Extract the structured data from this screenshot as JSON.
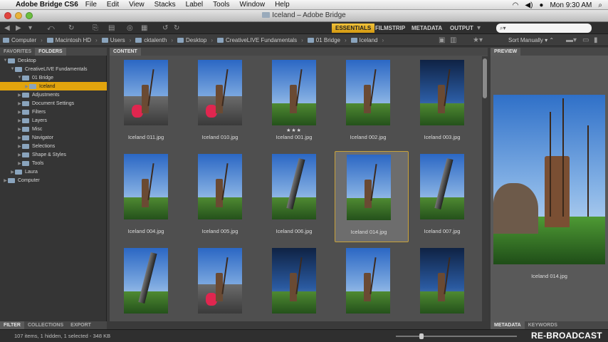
{
  "menubar": {
    "app_name": "Adobe Bridge CS6",
    "items": [
      "File",
      "Edit",
      "View",
      "Stacks",
      "Label",
      "Tools",
      "Window",
      "Help"
    ],
    "clock": "Mon 9:30 AM"
  },
  "window": {
    "title": "Iceland – Adobe Bridge"
  },
  "workspaces": {
    "essentials": "ESSENTIALS",
    "filmstrip": "FILMSTRIP",
    "metadata": "METADATA",
    "output": "OUTPUT"
  },
  "search": {
    "value": ""
  },
  "path": [
    "Computer",
    "Macintosh HD",
    "Users",
    "cktalenth",
    "Desktop",
    "CreativeLIVE Fundamentals",
    "01 Bridge",
    "Iceland"
  ],
  "sort": {
    "label": "Sort Manually"
  },
  "left_panel": {
    "tabs": [
      "FAVORITES",
      "FOLDERS"
    ],
    "tree": [
      {
        "label": "Desktop",
        "level": 0,
        "expanded": true
      },
      {
        "label": "CreativeLIVE Fundamentals",
        "level": 1,
        "expanded": true
      },
      {
        "label": "01 Bridge",
        "level": 2,
        "expanded": true
      },
      {
        "label": "Iceland",
        "level": 3,
        "selected": true
      },
      {
        "label": "Adjustments",
        "level": 2
      },
      {
        "label": "Document Settings",
        "level": 2
      },
      {
        "label": "Filters",
        "level": 2
      },
      {
        "label": "Layers",
        "level": 2
      },
      {
        "label": "Misc",
        "level": 2
      },
      {
        "label": "Navigator",
        "level": 2
      },
      {
        "label": "Selections",
        "level": 2
      },
      {
        "label": "Shape & Styles",
        "level": 2
      },
      {
        "label": "Tools",
        "level": 2
      },
      {
        "label": "Laura",
        "level": 1
      },
      {
        "label": "Computer",
        "level": 0
      }
    ],
    "bottom_tabs": [
      "FILTER",
      "COLLECTIONS",
      "EXPORT"
    ]
  },
  "content": {
    "tab": "CONTENT",
    "thumbnails": [
      {
        "name": "Iceland 011.jpg",
        "style": "road"
      },
      {
        "name": "Iceland 010.jpg",
        "style": "road"
      },
      {
        "name": "Iceland 001.jpg",
        "style": "statue",
        "rating": "★★★"
      },
      {
        "name": "Iceland 002.jpg",
        "style": "statue"
      },
      {
        "name": "Iceland 003.jpg",
        "style": "dark"
      },
      {
        "name": "Iceland 004.jpg",
        "style": "statue"
      },
      {
        "name": "Iceland 005.jpg",
        "style": "statue"
      },
      {
        "name": "Iceland 006.jpg",
        "style": "tower"
      },
      {
        "name": "Iceland 014.jpg",
        "style": "statue",
        "selected": true
      },
      {
        "name": "Iceland 007.jpg",
        "style": "tower"
      },
      {
        "name": "",
        "style": "tower"
      },
      {
        "name": "",
        "style": "road"
      },
      {
        "name": "",
        "style": "dark"
      },
      {
        "name": "",
        "style": "statue"
      },
      {
        "name": "",
        "style": "dark"
      }
    ]
  },
  "preview": {
    "tab": "PREVIEW",
    "caption": "Iceland 014.jpg",
    "bottom_tabs": [
      "METADATA",
      "KEYWORDS"
    ]
  },
  "status": {
    "text": "107 items, 1 hidden, 1 selected - 348 KB",
    "zoom_fraction": 0.21
  },
  "watermark": "RE-BROADCAST",
  "colors": {
    "accent": "#e2a40d",
    "background": "#4f4f4f"
  }
}
